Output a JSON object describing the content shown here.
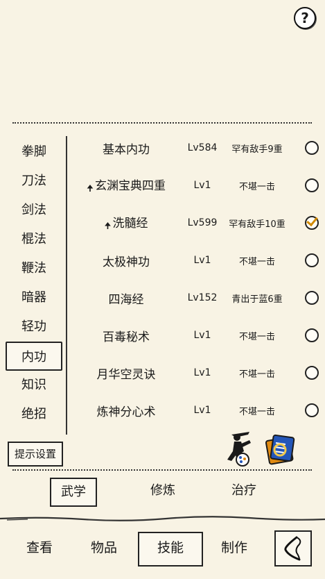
{
  "help": {
    "glyph": "?"
  },
  "categories": [
    "拳脚",
    "刀法",
    "剑法",
    "棍法",
    "鞭法",
    "暗器",
    "轻功",
    "内功",
    "知识",
    "绝招"
  ],
  "active_category": "内功",
  "skills": [
    {
      "name": "基本内功",
      "level": "Lv584",
      "rank": "罕有敌手9重",
      "upgrade": false,
      "checked": false
    },
    {
      "name": "玄渊宝典四重",
      "level": "Lv1",
      "rank": "不堪一击",
      "upgrade": true,
      "checked": false
    },
    {
      "name": "洗髓经",
      "level": "Lv599",
      "rank": "罕有敌手10重",
      "upgrade": true,
      "checked": true
    },
    {
      "name": "太极神功",
      "level": "Lv1",
      "rank": "不堪一击",
      "upgrade": false,
      "checked": false
    },
    {
      "name": "四海经",
      "level": "Lv152",
      "rank": "青出于蓝6重",
      "upgrade": false,
      "checked": false
    },
    {
      "name": "百毒秘术",
      "level": "Lv1",
      "rank": "不堪一击",
      "upgrade": false,
      "checked": false
    },
    {
      "name": "月华空灵诀",
      "level": "Lv1",
      "rank": "不堪一击",
      "upgrade": false,
      "checked": false
    },
    {
      "name": "炼神分心术",
      "level": "Lv1",
      "rank": "不堪一击",
      "upgrade": false,
      "checked": false
    }
  ],
  "hint_button": "提示设置",
  "sub_tabs": [
    "武学",
    "修炼",
    "治疗"
  ],
  "active_sub_tab": "武学",
  "bottom_tabs": [
    "查看",
    "物品",
    "技能",
    "制作"
  ],
  "active_bottom_tab": "技能",
  "icons": {
    "upgrade": "arrow-up-icon",
    "tool1": "martial-artist-icon",
    "tool2": "scroll-book-icon",
    "back": "back-arrow-icon"
  },
  "colors": {
    "background": "#f8f3e4",
    "check": "#d28a00",
    "accent_blue": "#2456b8",
    "accent_orange": "#e08a10"
  }
}
